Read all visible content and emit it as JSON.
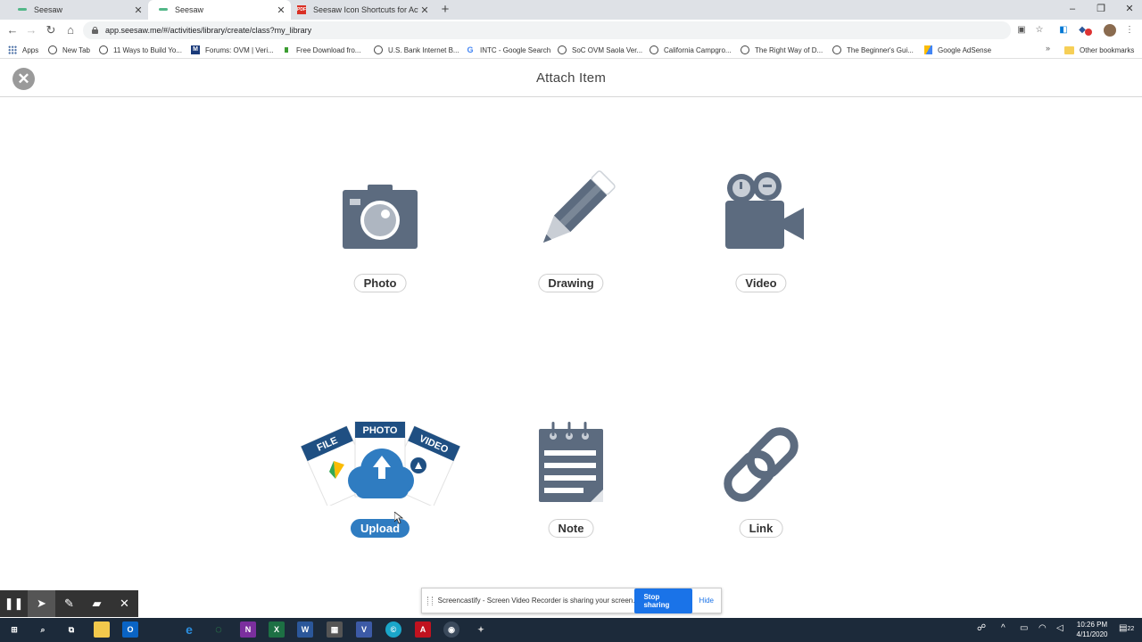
{
  "browser": {
    "tabs": [
      {
        "title": "Seesaw",
        "active": false
      },
      {
        "title": "Seesaw",
        "active": true
      },
      {
        "title": "Seesaw Icon Shortcuts for Activiti",
        "active": false
      }
    ],
    "url": "app.seesaw.me/#/activities/library/create/class?my_library",
    "bookmarks": [
      "Apps",
      "New Tab",
      "11 Ways to Build Yo...",
      "Forums: OVM | Veri...",
      "Free Download fro...",
      "U.S. Bank Internet B...",
      "INTC - Google Search",
      "SoC OVM Saola Ver...",
      "California Campgro...",
      "The Right Way of D...",
      "The Beginner's Gui...",
      "Google AdSense"
    ],
    "other_bookmarks": "Other bookmarks"
  },
  "page": {
    "title": "Attach Item",
    "options": [
      {
        "label": "Photo",
        "icon": "camera-icon"
      },
      {
        "label": "Drawing",
        "icon": "pencil-icon"
      },
      {
        "label": "Video",
        "icon": "video-camera-icon"
      },
      {
        "label": "Upload",
        "icon": "upload-cloud-icon",
        "tags": [
          "FILE",
          "PHOTO",
          "VIDEO"
        ]
      },
      {
        "label": "Note",
        "icon": "notepad-icon"
      },
      {
        "label": "Link",
        "icon": "chain-link-icon"
      }
    ]
  },
  "screencastify": {
    "message": "Screencastify - Screen Video Recorder is sharing your screen.",
    "stop_label": "Stop sharing",
    "hide_label": "Hide"
  },
  "taskbar": {
    "time": "10:26 PM",
    "date": "4/11/2020",
    "notification_count": "22"
  },
  "colors": {
    "icon_gray": "#5c6b7f",
    "accent_blue": "#2f7cc1",
    "upload_navy": "#1f4f82"
  }
}
